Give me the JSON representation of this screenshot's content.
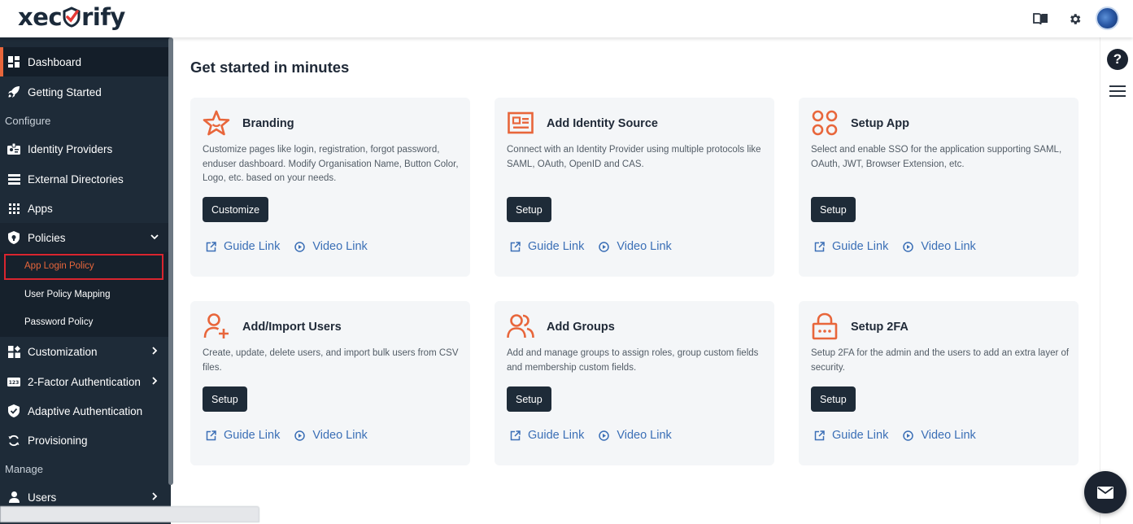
{
  "brand": {
    "logo_text_left": "xec",
    "logo_text_right": "rify",
    "accent_color": "#e8663b",
    "sidebar_color": "#1e2b38"
  },
  "header": {
    "icons": [
      "book-icon",
      "gear-icon",
      "avatar"
    ]
  },
  "sidebar": {
    "dashboard": "Dashboard",
    "getting_started": "Getting Started",
    "section_configure": "Configure",
    "identity_providers": "Identity Providers",
    "external_directories": "External Directories",
    "apps": "Apps",
    "policies": "Policies",
    "policies_sub": [
      "App Login Policy",
      "User Policy Mapping",
      "Password Policy"
    ],
    "customization": "Customization",
    "two_factor": "2-Factor Authentication",
    "adaptive": "Adaptive Authentication",
    "provisioning": "Provisioning",
    "section_manage": "Manage",
    "users": "Users"
  },
  "main": {
    "title": "Get started in minutes",
    "guide_link": "Guide Link",
    "video_link": "Video Link",
    "cards": [
      {
        "title": "Branding",
        "desc": "Customize pages like login, registration, forgot password, enduser dashboard. Modify Organisation Name, Button Color, Logo, etc. based on your needs.",
        "button": "Customize",
        "icon": "star-icon"
      },
      {
        "title": "Add Identity Source",
        "desc": "Connect with an Identity Provider using multiple protocols like SAML, OAuth, OpenID and CAS.",
        "button": "Setup",
        "icon": "id-card-icon"
      },
      {
        "title": "Setup App",
        "desc": "Select and enable SSO for the application supporting SAML, OAuth, JWT, Browser Extension, etc.",
        "button": "Setup",
        "icon": "command-icon"
      },
      {
        "title": "Add/Import Users",
        "desc": "Create, update, delete users, and import bulk users from CSV files.",
        "button": "Setup",
        "icon": "user-add-icon"
      },
      {
        "title": "Add Groups",
        "desc": "Add and manage groups to assign roles, group custom fields and membership custom fields.",
        "button": "Setup",
        "icon": "users-icon"
      },
      {
        "title": "Setup 2FA",
        "desc": "Setup 2FA for the admin and the users to add an extra layer of security.",
        "button": "Setup",
        "icon": "lock-icon"
      }
    ]
  },
  "rail": {
    "help": "?"
  }
}
